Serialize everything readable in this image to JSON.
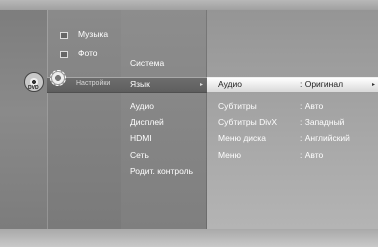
{
  "sidebar": {
    "items": [
      {
        "label": "Музыка",
        "icon": "music-icon"
      },
      {
        "label": "Фото",
        "icon": "photo-icon"
      },
      {
        "label": "Настройки",
        "icon": "gear-icon"
      }
    ],
    "disc_label": "DVD"
  },
  "categories": {
    "header": "Система",
    "selected": "Язык",
    "items": [
      "Аудио",
      "Дисплей",
      "HDMI",
      "Сеть",
      "Родит. контроль"
    ]
  },
  "language_settings": [
    {
      "label": "Аудио",
      "value": ": Оригинал",
      "selected": true
    },
    {
      "label": "Субтитры",
      "value": ": Авто",
      "selected": false
    },
    {
      "label": "Субтитры DivX",
      "value": ": Западный",
      "selected": false
    },
    {
      "label": "Меню диска",
      "value": ": Английский",
      "selected": false
    },
    {
      "label": "Меню",
      "value": ": Авто",
      "selected": false
    }
  ],
  "colors": {
    "selection_bg": "#ffffff",
    "highlight_bar": "#5e5e5e",
    "text": "#ffffff"
  }
}
